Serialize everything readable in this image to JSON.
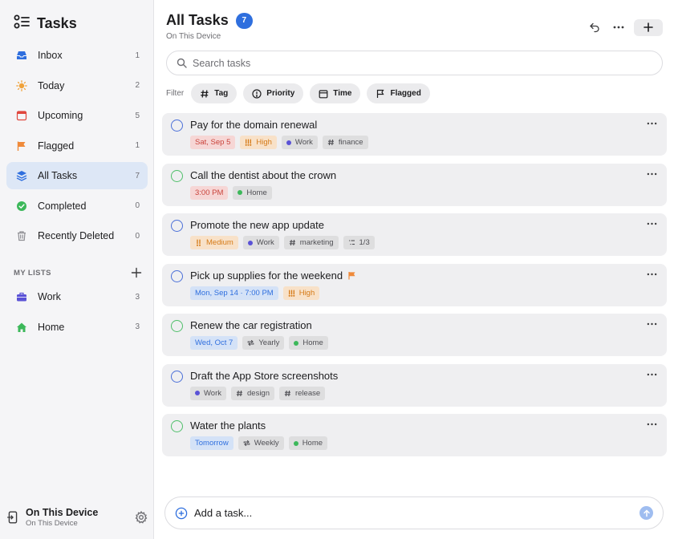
{
  "sidebar": {
    "app_title": "Tasks",
    "nav": [
      {
        "label": "Inbox",
        "count": "1",
        "icon": "inbox-icon",
        "color": "#2f6fde"
      },
      {
        "label": "Today",
        "count": "2",
        "icon": "sun-icon",
        "color": "#f0a23a"
      },
      {
        "label": "Upcoming",
        "count": "5",
        "icon": "calendar-icon",
        "color": "#e0473e"
      },
      {
        "label": "Flagged",
        "count": "1",
        "icon": "flag-icon",
        "color": "#ef8a3a"
      },
      {
        "label": "All Tasks",
        "count": "7",
        "icon": "stack-icon",
        "color": "#2f6fde",
        "active": true
      },
      {
        "label": "Completed",
        "count": "0",
        "icon": "check-circle-icon",
        "color": "#3cb85a"
      },
      {
        "label": "Recently Deleted",
        "count": "0",
        "icon": "trash-icon",
        "color": "#8e8e93"
      }
    ],
    "lists_header": "MY LISTS",
    "lists": [
      {
        "label": "Work",
        "count": "3",
        "icon": "briefcase-icon",
        "color": "#5a52d6"
      },
      {
        "label": "Home",
        "count": "3",
        "icon": "house-icon",
        "color": "#3cb85a"
      }
    ],
    "footer": {
      "title": "On This Device",
      "subtitle": "On This Device"
    }
  },
  "header": {
    "title": "All Tasks",
    "count": "7",
    "subtitle": "On This Device"
  },
  "search": {
    "placeholder": "Search tasks",
    "value": ""
  },
  "filters": {
    "label": "Filter",
    "chips": [
      {
        "label": "Tag",
        "icon": "hash-icon"
      },
      {
        "label": "Priority",
        "icon": "exclamation-circle-icon"
      },
      {
        "label": "Time",
        "icon": "calendar-icon"
      },
      {
        "label": "Flagged",
        "icon": "flag-outline-icon"
      }
    ]
  },
  "tasks": [
    {
      "title": "Pay for the domain renewal",
      "circle": "blue",
      "tags": [
        {
          "text": "Sat, Sep 5",
          "style": "red"
        },
        {
          "text": "High",
          "style": "orange",
          "icon": "priority-high-icon"
        },
        {
          "text": "Work",
          "style": "gray",
          "icon": "list-dot-icon",
          "dot": "#5a52d6"
        },
        {
          "text": "finance",
          "style": "gray",
          "icon": "hash-icon"
        }
      ]
    },
    {
      "title": "Call the dentist about the crown",
      "circle": "green",
      "tags": [
        {
          "text": "3:00 PM",
          "style": "red"
        },
        {
          "text": "Home",
          "style": "gray",
          "icon": "list-dot-icon",
          "dot": "#3cb85a"
        }
      ]
    },
    {
      "title": "Promote the new app update",
      "circle": "blue",
      "tags": [
        {
          "text": "Medium",
          "style": "orange",
          "icon": "priority-medium-icon"
        },
        {
          "text": "Work",
          "style": "gray",
          "icon": "list-dot-icon",
          "dot": "#5a52d6"
        },
        {
          "text": "marketing",
          "style": "gray",
          "icon": "hash-icon"
        },
        {
          "text": "1/3",
          "style": "gray",
          "icon": "subtasks-icon"
        }
      ]
    },
    {
      "title": "Pick up supplies for the weekend",
      "circle": "blue",
      "flagged": true,
      "tags": [
        {
          "text": "Mon, Sep 14 · 7:00 PM",
          "style": "blue"
        },
        {
          "text": "High",
          "style": "orange",
          "icon": "priority-high-icon"
        }
      ]
    },
    {
      "title": "Renew the car registration",
      "circle": "green",
      "tags": [
        {
          "text": "Wed, Oct 7",
          "style": "blue"
        },
        {
          "text": "Yearly",
          "style": "gray",
          "icon": "repeat-icon"
        },
        {
          "text": "Home",
          "style": "gray",
          "icon": "list-dot-icon",
          "dot": "#3cb85a"
        }
      ]
    },
    {
      "title": "Draft the App Store screenshots",
      "circle": "blue",
      "tags": [
        {
          "text": "Work",
          "style": "gray",
          "icon": "list-dot-icon",
          "dot": "#5a52d6"
        },
        {
          "text": "design",
          "style": "gray",
          "icon": "hash-icon"
        },
        {
          "text": "release",
          "style": "gray",
          "icon": "hash-icon"
        }
      ]
    },
    {
      "title": "Water the plants",
      "circle": "green",
      "tags": [
        {
          "text": "Tomorrow",
          "style": "blue"
        },
        {
          "text": "Weekly",
          "style": "gray",
          "icon": "repeat-icon"
        },
        {
          "text": "Home",
          "style": "gray",
          "icon": "list-dot-icon",
          "dot": "#3cb85a"
        }
      ]
    }
  ],
  "add_task": {
    "placeholder": "Add a task...",
    "value": ""
  },
  "colors": {
    "accent": "#2f6fde",
    "work": "#5a52d6",
    "home": "#3cb85a",
    "flag": "#ef8a3a"
  }
}
